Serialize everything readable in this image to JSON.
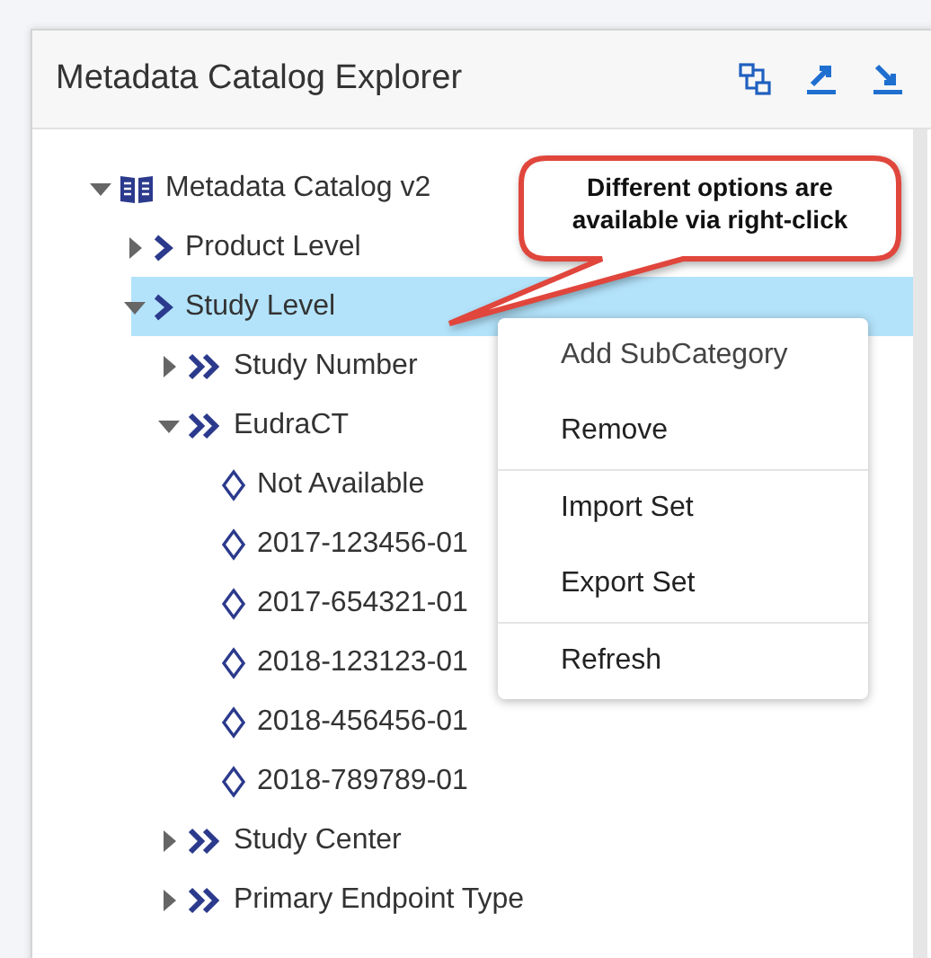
{
  "panel": {
    "title": "Metadata Catalog Explorer"
  },
  "tree": [
    {
      "label": "Metadata Catalog v2",
      "kind": "catalog",
      "expanded": true,
      "selected": false,
      "children": [
        {
          "label": "Product Level",
          "kind": "level",
          "expanded": false,
          "selected": false
        },
        {
          "label": "Study Level",
          "kind": "level",
          "expanded": true,
          "selected": true,
          "children": [
            {
              "label": "Study Number",
              "kind": "attribute",
              "expanded": false,
              "selected": false
            },
            {
              "label": "EudraCT",
              "kind": "attribute",
              "expanded": true,
              "selected": false,
              "children": [
                {
                  "label": "Not Available",
                  "kind": "value",
                  "selected": false
                },
                {
                  "label": "2017-123456-01",
                  "kind": "value",
                  "selected": false
                },
                {
                  "label": "2017-654321-01",
                  "kind": "value",
                  "selected": false
                },
                {
                  "label": "2018-123123-01",
                  "kind": "value",
                  "selected": false
                },
                {
                  "label": "2018-456456-01",
                  "kind": "value",
                  "selected": false
                },
                {
                  "label": "2018-789789-01",
                  "kind": "value",
                  "selected": false
                }
              ]
            },
            {
              "label": "Study Center",
              "kind": "attribute",
              "expanded": false,
              "selected": false
            },
            {
              "label": "Primary Endpoint Type",
              "kind": "attribute",
              "expanded": false,
              "selected": false
            }
          ]
        }
      ]
    }
  ],
  "callout": {
    "text": "Different options are available via right-click"
  },
  "context_menu": {
    "groups": [
      {
        "items": [
          "Add SubCategory",
          "Remove"
        ]
      },
      {
        "items": [
          "Import Set",
          "Export Set"
        ]
      },
      {
        "items": [
          "Refresh"
        ]
      }
    ]
  }
}
